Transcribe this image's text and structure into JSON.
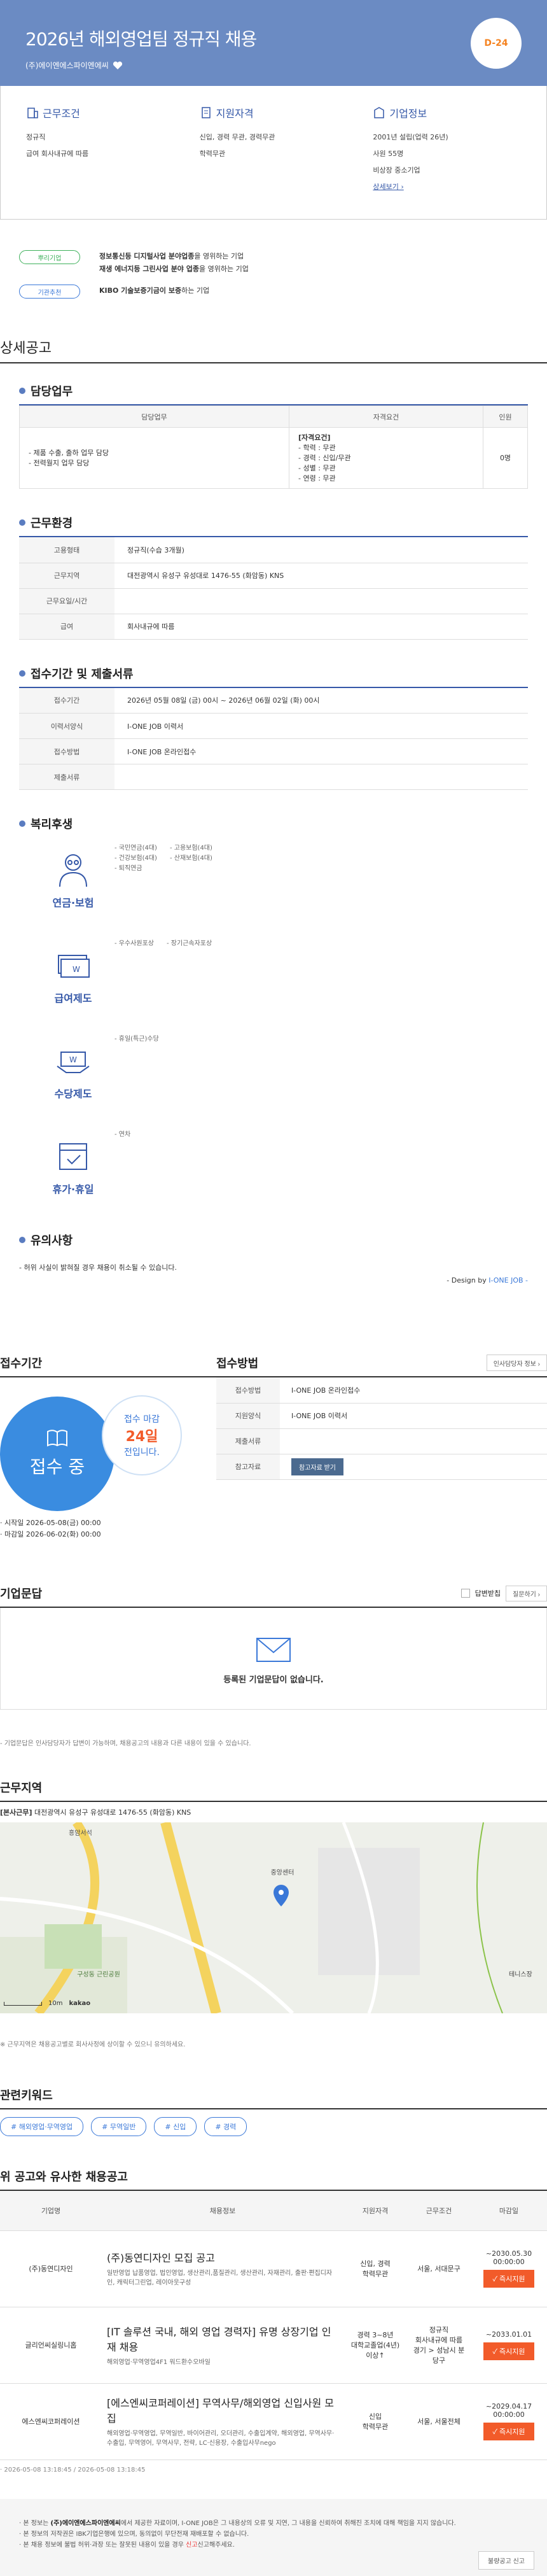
{
  "hero": {
    "title": "2026년 해외영업팀 정규직 채용",
    "company": "(주)에이엔에스파이엔에씨",
    "dday": "D-24"
  },
  "summary": {
    "conditions": {
      "title": "근무조건",
      "lines": [
        "정규직",
        "급여 회사내규에 따름"
      ]
    },
    "qualifications": {
      "title": "지원자격",
      "lines": [
        "신입, 경력 무관, 경력무관",
        "학력무관"
      ]
    },
    "company": {
      "title": "기업정보",
      "lines": [
        "2001년 설립(업력 26년)",
        "사원 55명",
        "비상장 중소기업"
      ],
      "link": "상세보기 ›"
    }
  },
  "badges": [
    {
      "label": "뿌리기업",
      "bold": "정보통신등 디지털사업 분야업종",
      "text": "을 영위하는 기업"
    },
    {
      "label": "",
      "bold": "재생 에너지등 그린사업 분야 업종",
      "text": "을 영위하는 기업"
    },
    {
      "label": "기관추천",
      "bold": "KIBO 기술보증기금이 보증",
      "text": "하는 기업"
    }
  ],
  "detail_heading": "상세공고",
  "duty": {
    "title": "담당업무",
    "headers": [
      "담당업무",
      "자격요건",
      "인원"
    ],
    "tasks": [
      "- 제품 수출, 출하 업무 담당",
      "- 전력월지 업무 담당"
    ],
    "req_title": "[자격요건]",
    "reqs": [
      "- 학력 : 무관",
      "- 경력 : 신입/무관",
      "- 성별 : 무관",
      "- 연령 : 무관"
    ],
    "count": "0명"
  },
  "env": {
    "title": "근무환경",
    "rows": [
      {
        "k": "고용형태",
        "v": "정규직(수습 3개월)"
      },
      {
        "k": "근무지역",
        "v": "대전광역시 유성구 유성대로 1476-55 (화암동) KNS"
      },
      {
        "k": "근무요일/시간",
        "v": ""
      },
      {
        "k": "급여",
        "v": "회사내규에 따름"
      }
    ]
  },
  "period": {
    "title": "접수기간 및 제출서류",
    "rows": [
      {
        "k": "접수기간",
        "v": "2026년 05월 08일 (금) 00시 ~ 2026년 06월 02일 (화) 00시"
      },
      {
        "k": "이력서양식",
        "v": "I-ONE JOB 이력서"
      },
      {
        "k": "접수방법",
        "v": "I-ONE JOB 온라인접수"
      },
      {
        "k": "제출서류",
        "v": ""
      }
    ]
  },
  "welfare": {
    "title": "복리후생",
    "items": [
      {
        "label": "연금·보험",
        "cols": [
          [
            "- 국민연금(4대)",
            "- 건강보험(4대)",
            "- 퇴직연금"
          ],
          [
            "- 고용보험(4대)",
            "- 산재보험(4대)"
          ]
        ]
      },
      {
        "label": "급여제도",
        "cols": [
          [
            "- 우수사원포상"
          ],
          [
            "- 장기근속자포상"
          ]
        ]
      },
      {
        "label": "수당제도",
        "cols": [
          [
            "- 휴일(특근)수당"
          ]
        ]
      },
      {
        "label": "휴가·휴일",
        "cols": [
          [
            "- 연차"
          ]
        ]
      }
    ]
  },
  "caution": {
    "title": "유의사항",
    "text": "- 허위 사실이 밝혀질 경우 채용이 취소될 수 있습니다.",
    "design_prefix": "- Design by",
    "design_brand": " I-ONE JOB -"
  },
  "apply": {
    "left_title": "접수기간",
    "status": "접수 중",
    "deadline_pre": "접수 마감",
    "deadline_days": "24일",
    "deadline_post": "전입니다.",
    "start": "· 시작일 2026-05-08(금) 00:00",
    "end": "· 마감일 2026-06-02(화) 00:00",
    "right_title": "접수방법",
    "contact_btn": "인사담당자 정보 ›",
    "rows": [
      {
        "k": "접수방법",
        "v": "I-ONE JOB 온라인접수"
      },
      {
        "k": "지원양식",
        "v": "I-ONE JOB 이력서"
      },
      {
        "k": "제출서류",
        "v": ""
      },
      {
        "k": "참고자료",
        "v": ""
      }
    ],
    "ref_btn": "참고자료 받기"
  },
  "inquiry": {
    "title": "기업문답",
    "my_answer": "답변받칩",
    "ask_btn": "질문하기 ›",
    "empty": "등록된 기업문답이 없습니다.",
    "note": "- 기업문답은 인사담당자가 답변이 가능하며, 채용공고의 내용과 다른 내용이 있을 수 있습니다."
  },
  "location": {
    "title": "근무지역",
    "tag": "[본사근무]",
    "addr": " 대전광역시 유성구 유성대로 1476-55 (화암동) KNS",
    "map_labels": [
      "중앙센터",
      "구성동 근린공원",
      "테니스장"
    ],
    "scale": "10m",
    "brand": "kakao",
    "note": "※ 근무지역은 채용공고별로 회사사정에 상이할 수 있으니 유의하세요."
  },
  "keywords": {
    "title": "관련키워드",
    "tags": [
      "# 해외영업·무역영업",
      "# 무역일반",
      "# 신입",
      "# 경력"
    ]
  },
  "similar": {
    "title": "위 공고와 유사한 채용공고",
    "headers": [
      "기업명",
      "채용정보",
      "지원자격",
      "근무조건",
      "마감일"
    ],
    "rows": [
      {
        "company": "(주)동연디자인",
        "title": "(주)동연디자인 모집 공고",
        "desc": "일반영업 납품영업, 법인영업, 생산관리,품질관리, 생산관리, 자재관리, 출판·편집디자인, 캐릭터그린업, 레이아웃구성",
        "qual": "신입, 경력\n학력무관",
        "cond": "서울, 서대문구",
        "deadline": "~2030.05.30 00:00:00",
        "btn": "✓ 즉시지원"
      },
      {
        "company": "글리언씨실링니홉",
        "title": "[IT 솔루션 국내, 해외 영업 경력자] 유명 상장기업 인재 채용",
        "desc": "해외영업·무역영업4F1 워드환수오바일",
        "qual": "경력 3~8년\n대학교졸업(4년) 이상↑",
        "cond": "정규직\n회사내규에 따름\n경기 > 성남시 분당구",
        "deadline": "~2033.01.01",
        "btn": "✓ 즉시지원"
      },
      {
        "company": "에스엔씨코퍼레이션",
        "title": "[에스엔씨코퍼레이션] 무역사무/해외영업 신입사원 모집",
        "desc": "해외영업·무역영업, 무역일반, 바이어관리, 오더관리, 수출입계약, 해외영업, 무역사무·수출입, 무역영어, 무역사무, 전략, LC·신용장, 수출입사무nego",
        "qual": "신입\n학력무관",
        "cond": "서울, 서울전체",
        "deadline": "~2029.04.17 00:00:00",
        "btn": "✓ 즉시지원"
      }
    ]
  },
  "footer": {
    "dates": "· 2026-05-08 13:18:45 / 2026-05-08 13:18:45",
    "lines": [
      {
        "pre": "본 정보는 ",
        "bold": "(주)에이엔에스파이엔에씨",
        "post": "에서 제공한 자료이며, I-ONE JOB은 그 내용상의 오류 및 지연, 그 내용을 신뢰하여 취해진 조치에 대해 책임을 지지 않습니다."
      },
      {
        "pre": "본 정보의 저작권은 ",
        "bold": "",
        "post": "IBK기업은행에 있으며, 동의없이 무단전재 재배포할 수 없습니다."
      },
      {
        "pre": "본 채용 정보에 불법 허위·과장 또는 잘못된 내용이 있을 경우 ",
        "bold": "",
        "post": "신고해주세요.",
        "red": "신고"
      }
    ],
    "report_btn": "불량공고 신고"
  },
  "colors": {
    "hero_bg": "#6b8bc3",
    "accent": "#3558a8",
    "orange": "#f5821f",
    "apply_btn": "#f25b2a"
  }
}
